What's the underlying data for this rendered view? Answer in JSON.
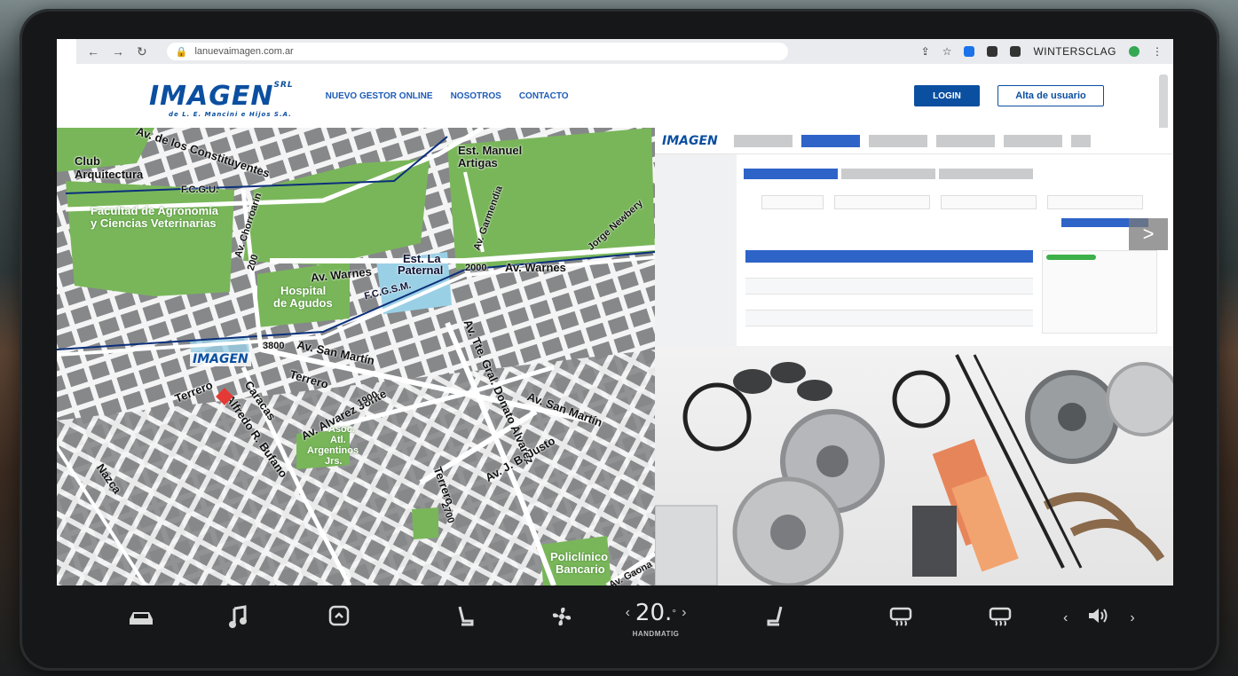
{
  "browser": {
    "url": "lanuevaimagen.com.ar",
    "profile": "WINTERSCLAG"
  },
  "site": {
    "logo": "IMAGEN",
    "logo_sup": "SRL",
    "logo_sub": "de L. E. Mancini e Hijos S.A.",
    "nav": [
      "NUEVO GESTOR ONLINE",
      "NOSOTROS",
      "CONTACTO"
    ],
    "login_label": "LOGIN",
    "signup_label": "Alta de usuario"
  },
  "map": {
    "labels": {
      "club": "Club",
      "arquitectura": "Arquitectura",
      "constituyentes": "Av. de los Constituyentes",
      "fcgu": "F.C.G.U.",
      "facultad1": "Facultad de Agronomía",
      "facultad2": "y Ciencias Veterinarias",
      "est_manuel": "Est. Manuel",
      "artigas": "Artigas",
      "garmendia": "Av. Garmendia",
      "newbery": "Jorge Newbery",
      "chorroarin": "Av. Chorroarín",
      "ch_num": "200",
      "warnes1": "Av. Warnes",
      "est_la": "Est. La",
      "paternal": "Paternal",
      "num2000": "2000",
      "warnes2": "Av. Warnes",
      "hospital": "Hospital",
      "agudos": "de Agudos",
      "fcgsm": "F.C.G.S.M.",
      "num3800": "3800",
      "san_martin1": "Av. San Martín",
      "terrero1": "Terrero",
      "terrero2": "Terrero",
      "caracas": "Caracas",
      "bufano": "Alfredo R. Bufano",
      "alvarez_jonte": "Av. Alvarez Jonte",
      "num1900": "1900",
      "donato": "Av. Tte. Gral. Donato Alvarez",
      "san_martin2": "Av. San Martín",
      "asoc": "Asoc.",
      "atl": "Atl.",
      "argentinos": "Argentinos",
      "jrs": "Jrs.",
      "jb_justo": "Av. J. B. Justo",
      "nazca": "Nazca",
      "terrero3": "Terrero",
      "num2700": "2700",
      "policlinico": "Policlínico",
      "bancario": "Bancario",
      "gaona": "Av. Gaona"
    },
    "pin_logo": "IMAGEN"
  },
  "catalog": {
    "logo": "IMAGEN",
    "next_glyph": ">"
  },
  "dock": {
    "temperature": "20.",
    "temp_degree": "°",
    "temp_left": "‹",
    "temp_right": "›",
    "mode_label": "HANDMATIG",
    "vol_left": "‹",
    "vol_right": "›"
  },
  "colors": {
    "brand_blue": "#0b4fa0",
    "map_green": "#79b65a",
    "map_gray": "#8a8c8e",
    "rail_blue": "#0b2f7a"
  }
}
